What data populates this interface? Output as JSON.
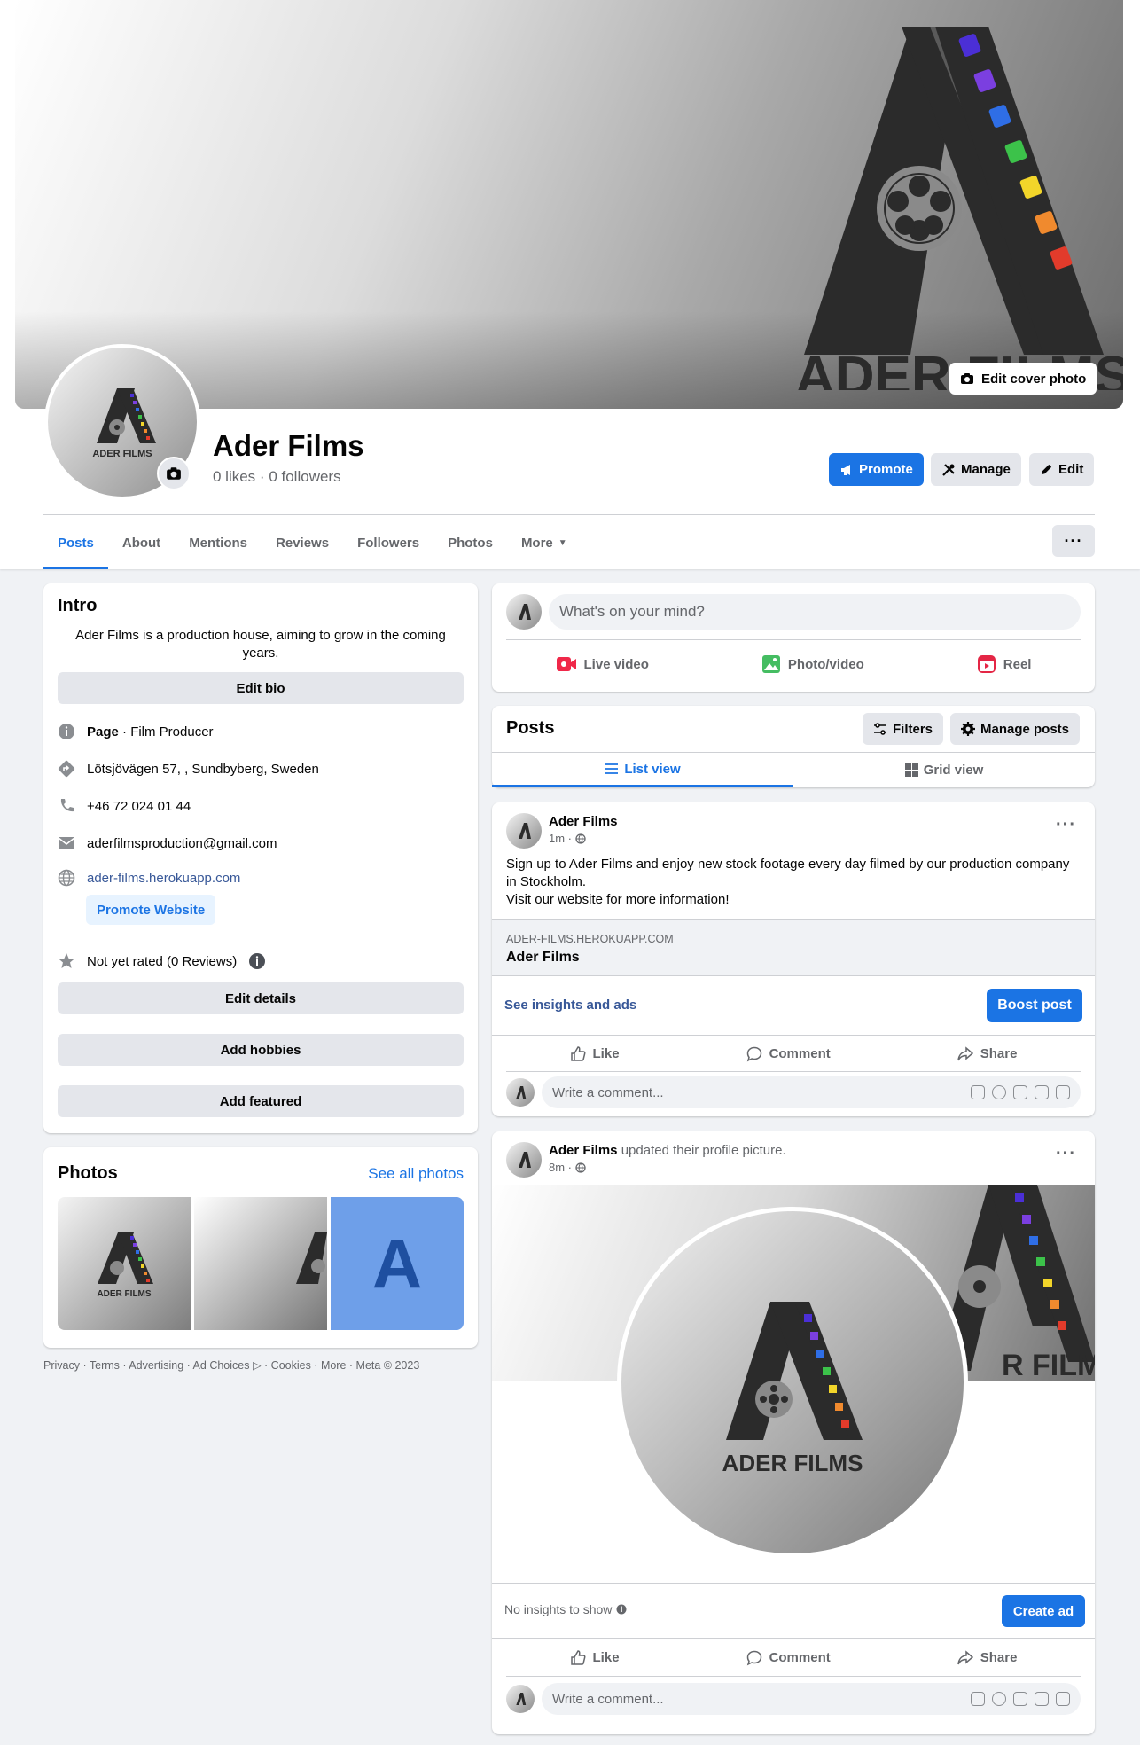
{
  "cover": {
    "edit_label": "Edit cover photo",
    "logo_text": "ADER FILMS"
  },
  "profile": {
    "name": "Ader Films",
    "likes": "0 likes",
    "sep": "·",
    "followers": "0 followers"
  },
  "actions": {
    "promote": "Promote",
    "manage": "Manage",
    "edit": "Edit"
  },
  "tabs": [
    "Posts",
    "About",
    "Mentions",
    "Reviews",
    "Followers",
    "Photos",
    "More"
  ],
  "intro": {
    "title": "Intro",
    "bio": "Ader Films is a production house, aiming to grow in the coming years.",
    "edit_bio": "Edit bio",
    "page_label": "Page",
    "page_category": " · Film Producer",
    "address": "Lötsjövägen 57, , Sundbyberg, Sweden",
    "phone": "+46 72 024 01 44",
    "email": "aderfilmsproduction@gmail.com",
    "website": "ader-films.herokuapp.com",
    "promote_website": "Promote Website",
    "rating": "Not yet rated (0 Reviews)",
    "edit_details": "Edit details",
    "add_hobbies": "Add hobbies",
    "add_featured": "Add featured"
  },
  "photos": {
    "title": "Photos",
    "see_all": "See all photos",
    "letter": "A",
    "thumb_logo_text": "ADER FILMS"
  },
  "footer": "Privacy · Terms · Advertising · Ad Choices ▷ · Cookies · More · Meta © 2023",
  "composer": {
    "placeholder": "What's on your mind?",
    "live": "Live video",
    "photo": "Photo/video",
    "reel": "Reel"
  },
  "posts_header": {
    "title": "Posts",
    "filters": "Filters",
    "manage": "Manage posts",
    "list_view": "List view",
    "grid_view": "Grid view"
  },
  "post1": {
    "author": "Ader Films",
    "time": "1m ·",
    "text_line1": "Sign up to Ader Films and enjoy new stock footage every day filmed by our production company in Stockholm.",
    "text_line2": "Visit our website for more information!",
    "link_domain": "ADER-FILMS.HEROKUAPP.COM",
    "link_title": "Ader Films",
    "insights": "See insights and ads",
    "boost": "Boost post",
    "like": "Like",
    "comment": "Comment",
    "share": "Share",
    "comment_placeholder": "Write a comment..."
  },
  "post2": {
    "author": "Ader Films",
    "action": " updated their profile picture.",
    "time": "8m ·",
    "logo_text": "ADER FILMS",
    "cover_logo_text": "R FILMS",
    "no_insights": "No insights to show",
    "create_ad": "Create ad",
    "like": "Like",
    "comment": "Comment",
    "share": "Share",
    "comment_placeholder": "Write a comment..."
  },
  "colors": {
    "accent": "#1b74e4",
    "stripes": [
      "#4b2fd6",
      "#7b3fe0",
      "#2f6ee6",
      "#3cc24a",
      "#f2d52a",
      "#f08a2e",
      "#e23b2b"
    ]
  }
}
